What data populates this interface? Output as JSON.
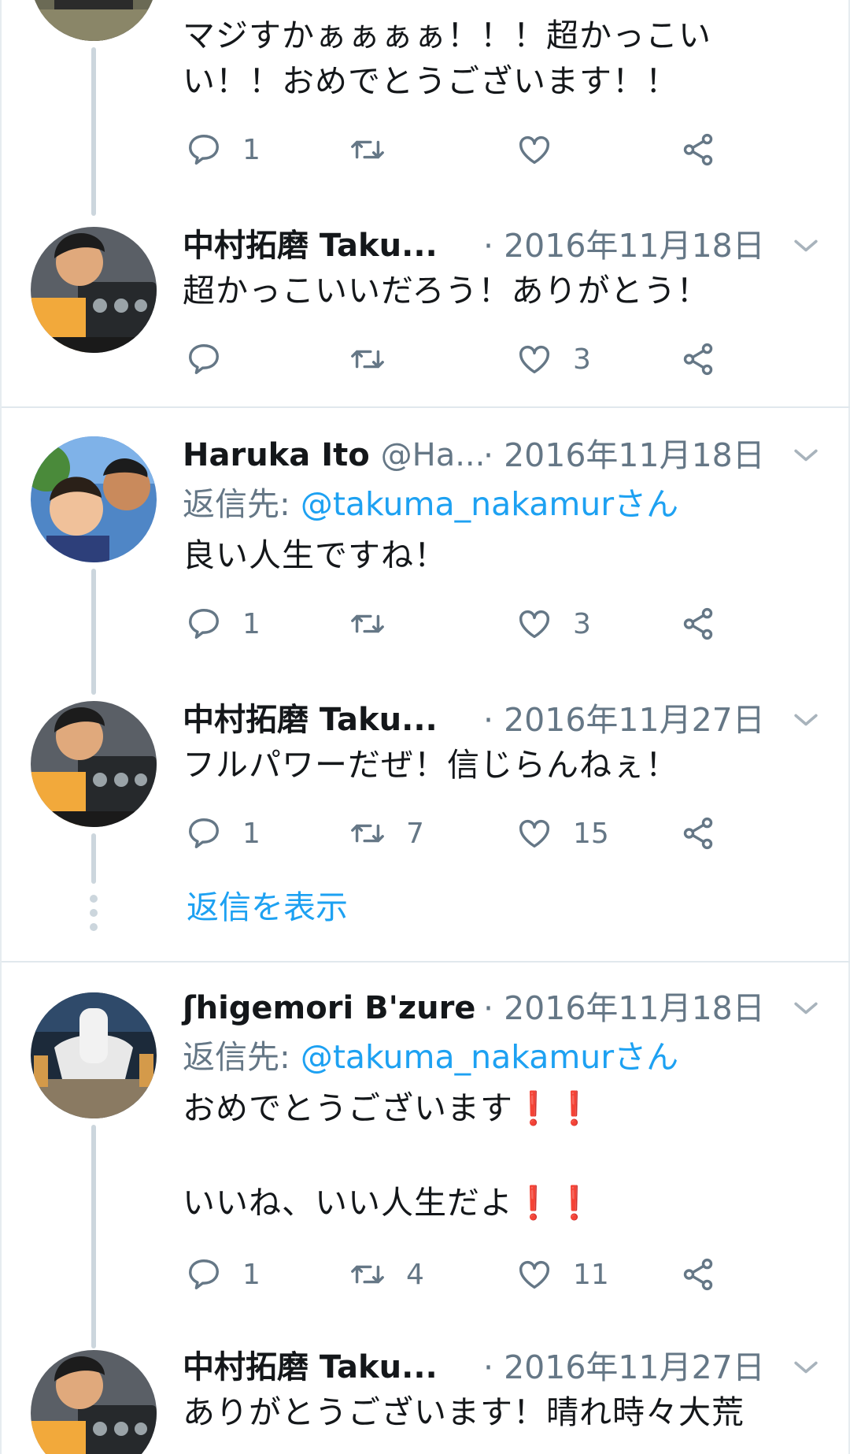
{
  "tweets": [
    {
      "text_lines": [
        "マジすかぁぁぁぁ！！！超かっこい",
        "い！！おめでとうございます！！"
      ],
      "reply_count": "1",
      "retweet_count": "",
      "like_count": ""
    },
    {
      "name": "中村拓磨 Taku...",
      "date": "· 2016年11月18日",
      "text_lines": [
        "超かっこいいだろう！ありがとう！"
      ],
      "reply_count": "",
      "retweet_count": "",
      "like_count": "3"
    },
    {
      "name": "Haruka Ito",
      "handle": "@Ha...",
      "date": "· 2016年11月18日",
      "reply_to_prefix": "返信先: ",
      "reply_to_mention": "@takuma_nakamurさん",
      "text_lines": [
        "良い人生ですね！"
      ],
      "reply_count": "1",
      "retweet_count": "",
      "like_count": "3"
    },
    {
      "name": "中村拓磨 Taku...",
      "date": "· 2016年11月27日",
      "text_lines": [
        "フルパワーだぜ！信じらんねぇ！"
      ],
      "reply_count": "1",
      "retweet_count": "7",
      "like_count": "15"
    },
    {
      "name": "ʃhigemori B'zure",
      "date": "· 2016年11月18日",
      "reply_to_prefix": "返信先: ",
      "reply_to_mention": "@takuma_nakamurさん",
      "text_line1": "おめでとうございます",
      "text_line2": "いいね、いい人生だよ",
      "excl": "❗❗",
      "reply_count": "1",
      "retweet_count": "4",
      "like_count": "11"
    },
    {
      "name": "中村拓磨 Taku...",
      "date": "· 2016年11月27日",
      "text_lines": [
        "ありがとうございます！晴れ時々大荒"
      ]
    }
  ],
  "show_replies_label": "返信を表示",
  "colors": {
    "accent": "#1da1f2",
    "secondary_text": "#657786",
    "divider": "#e1e8ed",
    "thread_line": "#ccd6dd",
    "emoji_red": "#e0245e"
  },
  "icons": [
    "reply-icon",
    "retweet-icon",
    "like-icon",
    "share-icon",
    "chevron-down-icon"
  ]
}
